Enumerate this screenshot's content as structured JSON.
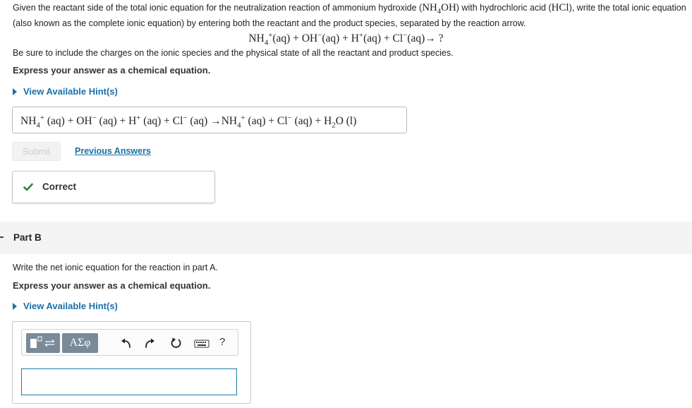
{
  "partA": {
    "intro_part1": "Given the reactant side of the total ionic equation for the neutralization reaction of ammonium hydroxide (",
    "intro_nh4oh": "NH",
    "intro_nh4oh_sub": "4",
    "intro_nh4oh_tail": "OH",
    "intro_part2": ") with hydrochloric acid (",
    "intro_hcl": "HCl",
    "intro_part3": "), write the total ionic equation (also known as the complete ionic equation) by entering both the reactant and the product species, separated by the reaction arrow.",
    "given_equation": {
      "nh4": "NH",
      "nh4_sub": "4",
      "nh4_sup": "+",
      "rest1": "(aq) + OH",
      "oh_sup": "−",
      "rest2": "(aq) + H",
      "h_sup": "+",
      "rest3": "(aq) + Cl",
      "cl_sup": "−",
      "rest4": "(aq)→ ?"
    },
    "charges_note": "Be sure to include the charges on the ionic species and the physical state of all the reactant and product species.",
    "express_label": "Express your answer as a chemical equation.",
    "hint_label": "View Available Hint(s)",
    "answer": {
      "nh4": "NH",
      "nh4_sub": "4",
      "nh4_sup": "+",
      "t1": " (aq) + OH",
      "oh_sup": "−",
      "t2": " (aq) + H",
      "h_sup": "+",
      "t3": " (aq) + Cl",
      "cl_sup": "−",
      "t4": " (aq) →NH",
      "nh4b_sub": "4",
      "nh4b_sup": "+",
      "t5": " (aq) + Cl",
      "cl2_sup": "−",
      "t6": " (aq) + H",
      "h2o_sub": "2",
      "t7": "O (l)"
    },
    "submit_label": "Submit",
    "previous_answers_label": "Previous Answers",
    "correct_label": "Correct",
    "correct_color": "#2e8b2e"
  },
  "partB": {
    "title": "Part B",
    "prompt": "Write the net ionic equation for the reaction in part A.",
    "express_label": "Express your answer as a chemical equation.",
    "hint_label": "View Available Hint(s)",
    "toolbar": {
      "greek_label": "ΑΣφ",
      "help_label": "?",
      "icons": [
        "template-icon",
        "greek-symbols-icon",
        "undo-icon",
        "redo-icon",
        "reset-icon",
        "keyboard-icon",
        "help-icon"
      ]
    }
  },
  "colors": {
    "link": "#1a6fa8",
    "toolbar_button": "#7a8a99",
    "input_border": "#1a7ca8"
  }
}
